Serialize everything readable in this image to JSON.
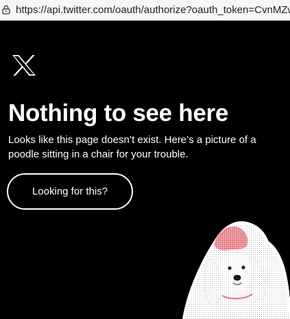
{
  "browser": {
    "url": "https://api.twitter.com/oauth/authorize?oauth_token=CvnMZwAAAAAA"
  },
  "page": {
    "title": "Nothing to see here",
    "message": "Looks like this page doesn’t exist. Here’s a picture of a poodle sitting in a chair for your trouble.",
    "button_label": "Looking for this?"
  },
  "icons": {
    "lock": "lock-icon",
    "logo": "x-logo-icon"
  },
  "colors": {
    "background": "#000000",
    "text": "#ffffff",
    "url_bar": "#f7f7f7",
    "poodle_accent": "#d9485a"
  }
}
